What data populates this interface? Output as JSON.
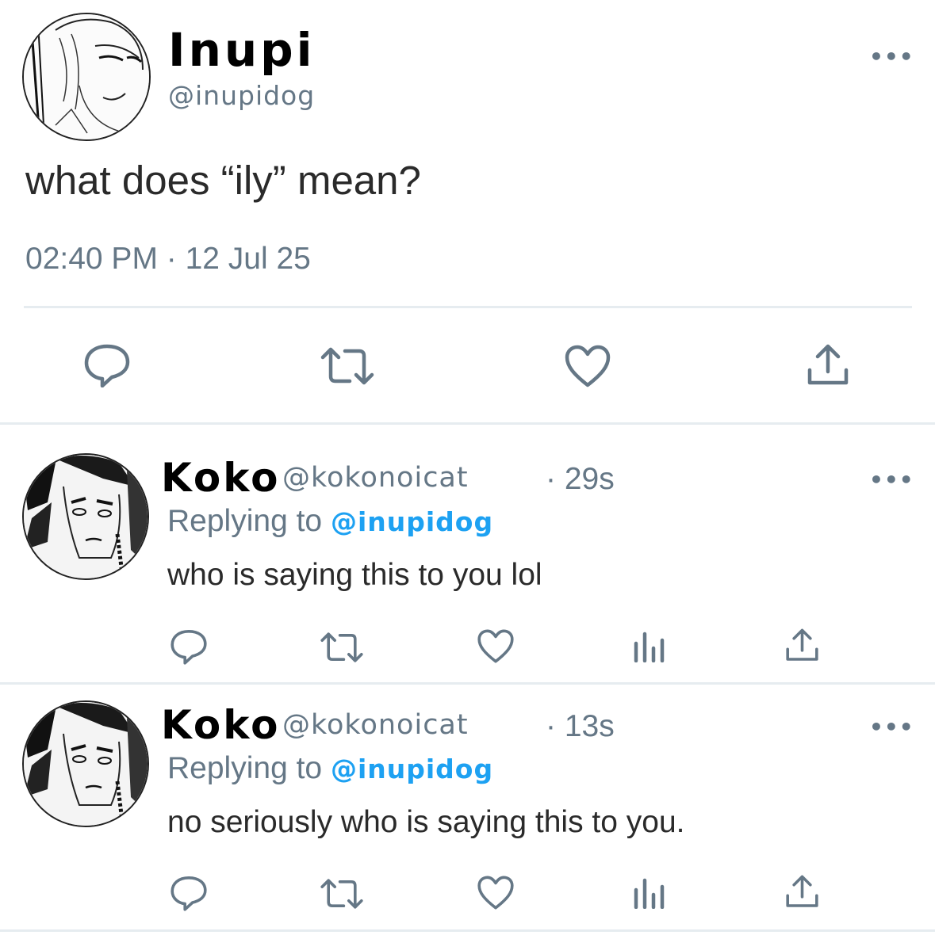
{
  "main_tweet": {
    "display_name": "Inupi",
    "handle": "@inupidog",
    "text": "what does “ily” mean?",
    "timestamp": "02:40 PM · 12 Jul 25",
    "more_label": "•••"
  },
  "replies": [
    {
      "display_name": "Koko",
      "handle": "@kokonoicat",
      "time": "· 29s",
      "replying_prefix": "Replying to ",
      "replying_handle": "@inupidog",
      "text": "who is saying this to you lol",
      "more_label": "•••"
    },
    {
      "display_name": "Koko",
      "handle": "@kokonoicat",
      "time": "· 13s",
      "replying_prefix": "Replying to ",
      "replying_handle": "@inupidog",
      "text": "no seriously who is saying this to you.",
      "more_label": "•••"
    }
  ],
  "icons": {
    "reply": "reply-icon",
    "retweet": "retweet-icon",
    "like": "like-icon",
    "analytics": "analytics-icon",
    "share": "share-icon"
  },
  "colors": {
    "link": "#1da1f2",
    "muted": "#657786",
    "divider": "#e6ecf0",
    "icon": "#657786"
  }
}
